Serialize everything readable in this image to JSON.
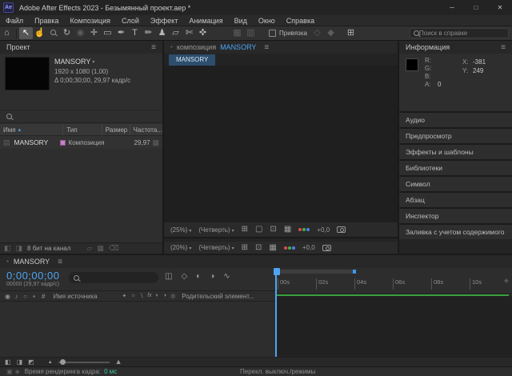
{
  "titlebar": {
    "app_icon": "Ae",
    "title": "Adobe After Effects 2023 - Безымянный проект.aep *"
  },
  "menubar": [
    "Файл",
    "Правка",
    "Композиция",
    "Слой",
    "Эффект",
    "Анимация",
    "Вид",
    "Окно",
    "Справка"
  ],
  "toolbar": {
    "snap_label": "Привязка",
    "search_placeholder": "Поиск в справке"
  },
  "project": {
    "tab": "Проект",
    "comp_name": "MANSORY",
    "dims": "1920 x 1080 (1,00)",
    "duration": "Δ 0;00;30;00, 29,97 кадр/с",
    "columns": [
      "Имя",
      "Тип",
      "Размер",
      "Частота..."
    ],
    "row": {
      "name": "MANSORY",
      "type": "Композиция",
      "rate": "29,97"
    },
    "depth": "8 бит на канал"
  },
  "comp_viewer": {
    "tab_kind": "композиция",
    "tab_name": "MANSORY",
    "subtab": "MANSORY",
    "zoom": "(25%)",
    "quality": "(Четверть)",
    "exposure": "+0,0"
  },
  "footage_viewer": {
    "zoom": "(20%)",
    "quality": "(Четверть)",
    "exposure": "+0,0"
  },
  "info": {
    "title": "Информация",
    "r": "R:",
    "g": "G:",
    "b": "B:",
    "a": "A:",
    "a_value": "0",
    "x_label": "X:",
    "x_value": "-381",
    "y_label": "Y:",
    "y_value": "249"
  },
  "panels": [
    "Аудио",
    "Предпросмотр",
    "Эффекты и шаблоны",
    "Библиотеки",
    "Символ",
    "Абзац",
    "Инспектор",
    "Заливка с учетом содержимого"
  ],
  "timeline": {
    "tab": "MANSORY",
    "timecode": "0;00;00;00",
    "frame_info": "00000 (29,97 кадр/с)",
    "hash": "#",
    "col_name": "Имя источника",
    "col_parent": "Родительский элемент...",
    "ruler": [
      "00s",
      "02s",
      "04s",
      "06s",
      "08s",
      "10s"
    ]
  },
  "status": {
    "render_label": "Время рендеринга кадра:",
    "render_value": "0 мс",
    "modes_label": "Перекл. выключ./режимы"
  },
  "icons": {
    "menu": "≡",
    "home": "⌂",
    "selection": "↖",
    "hand": "☝",
    "rotate": "↻",
    "camera": "◉",
    "pan": "✛",
    "rect": "▭",
    "pen": "✒",
    "text": "T",
    "brush": "✏",
    "stamp": "♟",
    "eraser": "▱",
    "roto": "✄",
    "puppet": "✜",
    "ws1": "▦",
    "ws2": "▥",
    "snap1": "◇",
    "snap2": "◆",
    "grid": "⊞",
    "min": "─",
    "max": "□",
    "close": "✕",
    "dd": "▾",
    "sort": "▴",
    "safe": "⊞",
    "maskvis": "▢",
    "roi": "⊡",
    "checker": "▦",
    "flow": "◫",
    "draft": "◇",
    "fblend": "◐",
    "mblur": "◑",
    "graph": "∿",
    "eye": "◉",
    "audio": "♪",
    "solo": "○",
    "lock": "▪",
    "shy": "✦",
    "sun": "☼",
    "quality": "∖",
    "fx": "fx",
    "adj": "◎",
    "film": "▤",
    "folder": "▱",
    "compicon": "▦",
    "trash": "⌫",
    "pane1": "◧",
    "pane2": "◨",
    "pane3": "◩",
    "mtn": "▲",
    "marker": "◈",
    "badge": "▪",
    "stat1": "▣",
    "stat2": "◈"
  }
}
